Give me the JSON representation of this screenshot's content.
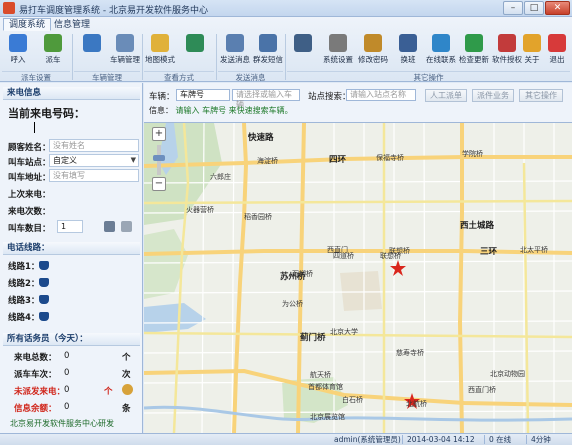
{
  "window": {
    "title": "易打车调度管理系统 - 北京易开发软件服务中心",
    "minimize": "–",
    "maximize": "□",
    "close": "✕"
  },
  "ribbon": {
    "tabs": [
      "调度系统",
      "信息管理"
    ],
    "tools": [
      {
        "label": "呼入",
        "icon": "phone-in-icon",
        "color": "#3a7bd5"
      },
      {
        "label": "派车",
        "icon": "car-icon",
        "color": "#4f9a3c"
      },
      {
        "label": "",
        "icon": "dispatch-icon",
        "color": "#3b78c2"
      },
      {
        "label": "车辆管理",
        "icon": "vehicle-icon",
        "color": "#6a8cb8"
      },
      {
        "label": "地图模式",
        "icon": "map-mode-icon",
        "color": "#e0b13a"
      },
      {
        "label": "",
        "icon": "refresh-icon",
        "color": "#2e8b57"
      },
      {
        "label": "发送消息",
        "icon": "message-icon",
        "color": "#5a7fb0"
      },
      {
        "label": "群发短信",
        "icon": "sms-icon",
        "color": "#4a73a8"
      },
      {
        "label": "",
        "icon": "keypad-icon",
        "color": "#3f5f86"
      },
      {
        "label": "系统设置",
        "icon": "settings-icon",
        "color": "#7a7a7a"
      },
      {
        "label": "修改密码",
        "icon": "key-icon",
        "color": "#c08a2a"
      },
      {
        "label": "换班",
        "icon": "shift-icon",
        "color": "#3a5f95"
      },
      {
        "label": "在线联系",
        "icon": "online-icon",
        "color": "#2f86c9"
      },
      {
        "label": "检查更新",
        "icon": "update-icon",
        "color": "#2f9a4a"
      },
      {
        "label": "软件授权",
        "icon": "license-icon",
        "color": "#c23b3b"
      },
      {
        "label": "关于",
        "icon": "about-icon",
        "color": "#e2a32b"
      },
      {
        "label": "退出",
        "icon": "exit-icon",
        "color": "#d73a3a"
      }
    ],
    "groups": [
      "派车设置",
      "车辆管理",
      "查看方式",
      "发送消息",
      "其它操作"
    ]
  },
  "caller": {
    "section_title": "来电信息",
    "current_caller_label": "当前来电号码：",
    "fields": [
      {
        "label": "顾客姓名：",
        "value": "",
        "placeholder": "没有姓名"
      },
      {
        "label": "叫车站点：",
        "value": "自定义",
        "placeholder": ""
      },
      {
        "label": "叫车地址：",
        "value": "",
        "placeholder": "没有填写"
      }
    ],
    "last_call_label": "上次来电：",
    "call_count_label": "来电次数：",
    "car_count_label": "叫车数目：",
    "car_count_value": "1"
  },
  "lines": {
    "section_title": "电话线路：",
    "items": [
      "线路1：",
      "线路2：",
      "线路3：",
      "线路4："
    ]
  },
  "stats": {
    "section_title": "所有话务员（今天）：",
    "rows": [
      {
        "label": "来电总数：",
        "value": "0",
        "unit": "个",
        "red": false
      },
      {
        "label": "派车车次：",
        "value": "0",
        "unit": "次",
        "red": false
      },
      {
        "label": "未派发来电：",
        "value": "0",
        "unit": "个",
        "red": true
      },
      {
        "label": "信息余额：",
        "value": "0",
        "unit": "条",
        "red": true
      }
    ],
    "footer": "北京易开发软件服务中心研发"
  },
  "search": {
    "vehicle_label": "车辆：",
    "vehicle_type": "车牌号",
    "vehicle_placeholder": "请选择或输入车辆",
    "site_label": "站点搜索：",
    "site_placeholder": "请输入站点名称",
    "buttons": [
      "人工派单",
      "派件业务",
      "其它操作"
    ],
    "tip_key": "信息：",
    "tip_value": "请输入 车牌号 来快速搜索车辆。"
  },
  "map": {
    "labels": [
      {
        "text": "快速路",
        "cls": "road",
        "l": 104,
        "t": 8
      },
      {
        "text": "学院桥",
        "cls": "",
        "l": 318,
        "t": 26
      },
      {
        "text": "海淀桥",
        "cls": "",
        "l": 113,
        "t": 33
      },
      {
        "text": "四环",
        "cls": "road",
        "l": 185,
        "t": 30
      },
      {
        "text": "保福寺桥",
        "cls": "",
        "l": 232,
        "t": 30
      },
      {
        "text": "六郎庄",
        "cls": "",
        "l": 66,
        "t": 49
      },
      {
        "text": "火器营桥",
        "cls": "",
        "l": 42,
        "t": 82
      },
      {
        "text": "稻香园桥",
        "cls": "",
        "l": 100,
        "t": 89
      },
      {
        "text": "西土城路",
        "cls": "road",
        "l": 316,
        "t": 96
      },
      {
        "text": "三环",
        "cls": "road",
        "l": 336,
        "t": 122
      },
      {
        "text": "北太平桥",
        "cls": "",
        "l": 376,
        "t": 122
      },
      {
        "text": "西直门",
        "cls": "",
        "l": 183,
        "t": 122
      },
      {
        "text": "联想桥",
        "cls": "",
        "l": 245,
        "t": 123
      },
      {
        "text": "四道桥",
        "cls": "",
        "l": 189,
        "t": 128
      },
      {
        "text": "联想桥",
        "cls": "",
        "l": 236,
        "t": 128
      },
      {
        "text": "万柳桥",
        "cls": "",
        "l": 148,
        "t": 146
      },
      {
        "text": "苏州桥",
        "cls": "big",
        "l": 136,
        "t": 147
      },
      {
        "text": "为公桥",
        "cls": "",
        "l": 138,
        "t": 176
      },
      {
        "text": "北京大学",
        "cls": "",
        "l": 186,
        "t": 204
      },
      {
        "text": "蓟门桥",
        "cls": "big",
        "l": 156,
        "t": 208
      },
      {
        "text": "慈寿寺桥",
        "cls": "",
        "l": 252,
        "t": 225
      },
      {
        "text": "航天桥",
        "cls": "",
        "l": 166,
        "t": 247
      },
      {
        "text": "首都体育馆",
        "cls": "",
        "l": 164,
        "t": 259
      },
      {
        "text": "白石桥",
        "cls": "",
        "l": 198,
        "t": 272
      },
      {
        "text": "北京动物园",
        "cls": "",
        "l": 346,
        "t": 246
      },
      {
        "text": "西直门桥",
        "cls": "",
        "l": 324,
        "t": 262
      },
      {
        "text": "北京展览馆",
        "cls": "",
        "l": 166,
        "t": 289
      },
      {
        "text": "北航桥",
        "cls": "",
        "l": 262,
        "t": 276
      }
    ]
  },
  "status": {
    "user": "admin(系统管理员)",
    "datetime": "2014-03-04 14:12",
    "online": "0 在线",
    "count": "4分钟"
  }
}
